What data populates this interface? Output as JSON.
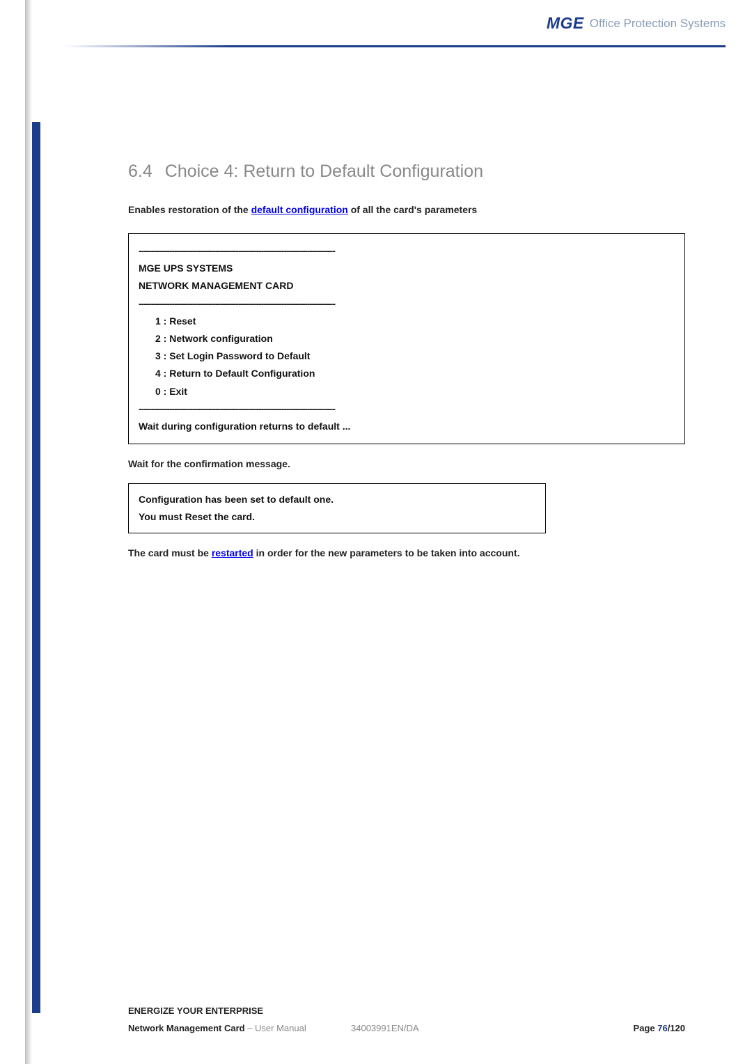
{
  "header": {
    "logo_text": "MGE",
    "subtitle": "Office Protection Systems"
  },
  "section": {
    "number": "6.4",
    "title": "Choice 4: Return to Default Configuration"
  },
  "intro": {
    "prefix": "Enables restoration of the ",
    "link": "default configuration",
    "suffix": " of all the card's parameters"
  },
  "terminal": {
    "dashes": "-----------------------------------------------------------------------------",
    "line1": "MGE UPS SYSTEMS",
    "line2": "NETWORK MANAGEMENT CARD",
    "menu": [
      "1 : Reset",
      "2 : Network configuration",
      "3 : Set Login Password to Default",
      "4 : Return to Default Configuration",
      "0 : Exit"
    ],
    "wait_msg": "Wait during configuration returns to default ..."
  },
  "confirm_prompt": "Wait for the confirmation message.",
  "confirm_box": {
    "line1": "Configuration has been set to default one.",
    "line2": "You must Reset the card."
  },
  "restart": {
    "prefix": "The card must be ",
    "link": "restarted",
    "suffix": " in order for the new parameters to be taken into account."
  },
  "footer": {
    "tagline": "ENERGIZE YOUR ENTERPRISE",
    "doc_title_bold": "Network Management Card",
    "doc_title_rest": " – User Manual",
    "doc_code": "34003991EN/DA",
    "page_label": "Page ",
    "page_current": "76",
    "page_total": "/120"
  }
}
